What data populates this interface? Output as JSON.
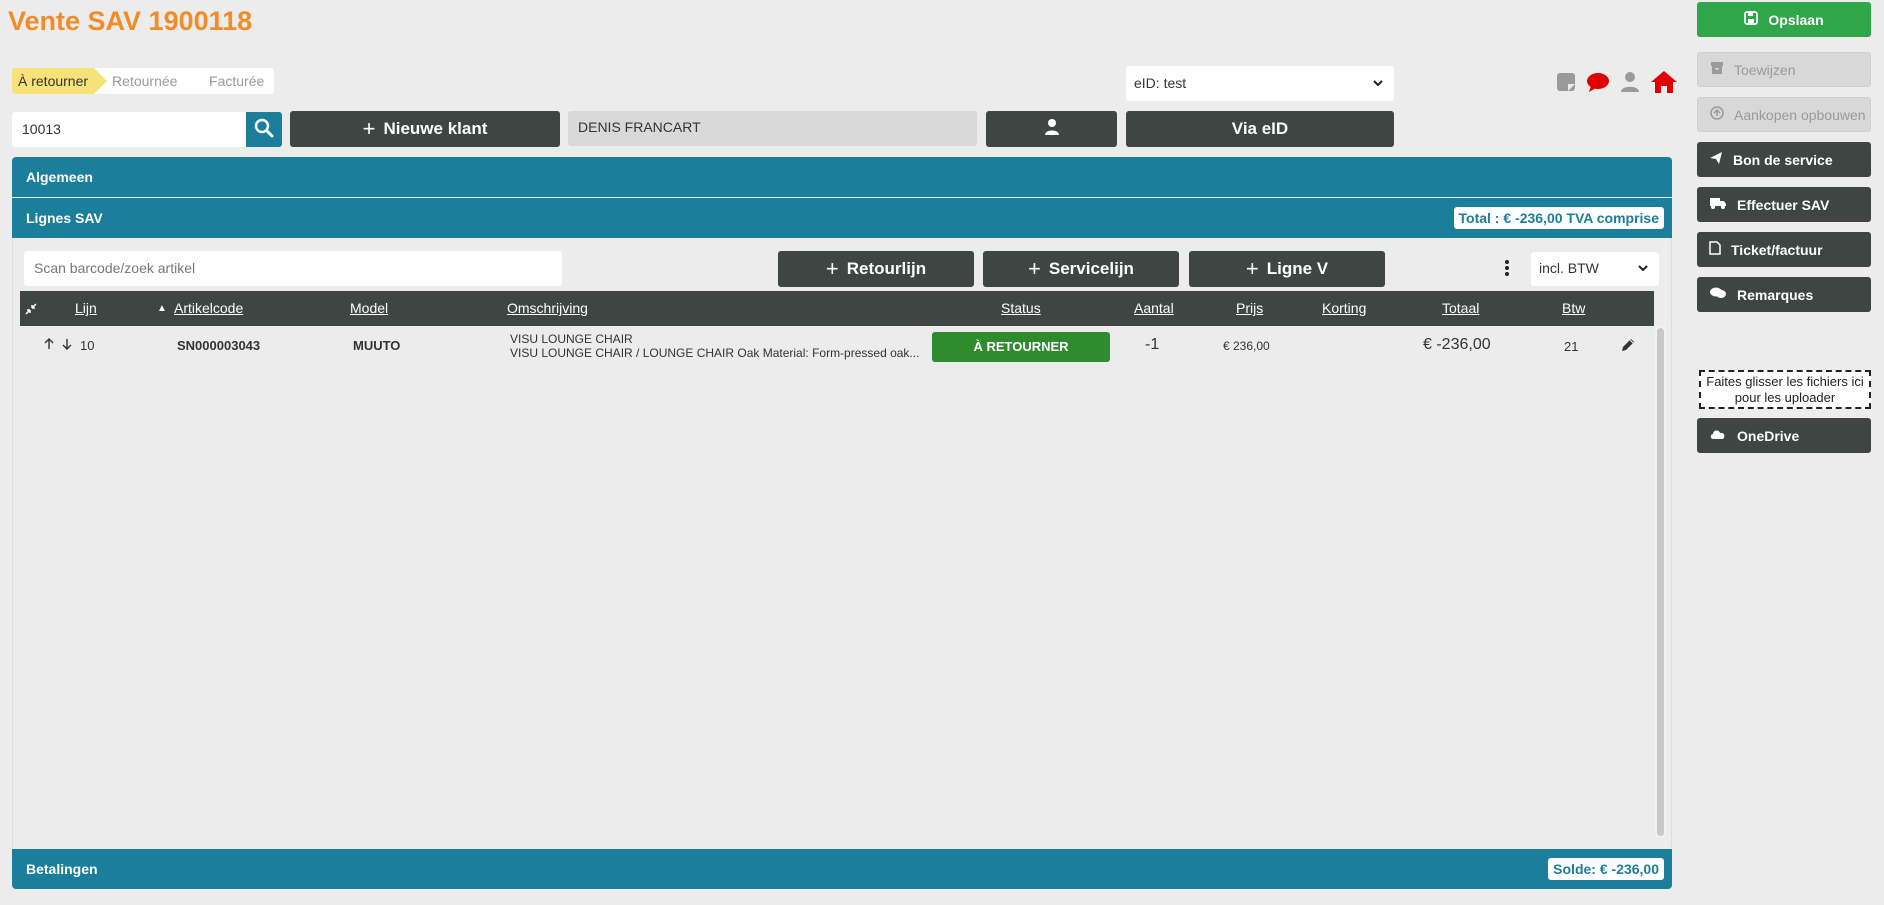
{
  "header": {
    "title": "Vente SAV 1900118"
  },
  "steps": [
    "À retourner",
    "Retournée",
    "Facturée"
  ],
  "eid_select": {
    "value": "eID: test"
  },
  "customer": {
    "number": "10013",
    "new_button": "Nieuwe klant",
    "name": "DENIS FRANCART",
    "via_eid_button": "Via eID"
  },
  "sections": {
    "algemeen": "Algemeen",
    "lignes": {
      "label": "Lignes SAV",
      "total": "Total : € -236,00 TVA comprise"
    },
    "betalingen": {
      "label": "Betalingen",
      "solde": "Solde: € -236,00"
    }
  },
  "lines_toolbar": {
    "scan_placeholder": "Scan barcode/zoek artikel",
    "retourlijn": "Retourlijn",
    "servicelijn": "Servicelijn",
    "ligne_v": "Ligne V",
    "price_mode": "incl. BTW"
  },
  "table": {
    "columns": [
      "Lijn",
      "Artikelcode",
      "Model",
      "Omschrijving",
      "Status",
      "Aantal",
      "Prijs",
      "Korting",
      "Totaal",
      "Btw"
    ],
    "rows": [
      {
        "lijn": "10",
        "artikelcode": "SN000003043",
        "model": "MUUTO",
        "omschrijving_1": "VISU LOUNGE CHAIR",
        "omschrijving_2": "VISU LOUNGE CHAIR / LOUNGE CHAIR Oak Material: Form-pressed oak...",
        "status": "À RETOURNER",
        "aantal": "-1",
        "prijs": "€ 236,00",
        "korting": "",
        "totaal": "€ -236,00",
        "btw": "21"
      }
    ]
  },
  "sidebar": {
    "save": "Opslaan",
    "assign": "Toewijzen",
    "build_purchases": "Aankopen opbouwen",
    "service_voucher": "Bon de service",
    "perform_sav": "Effectuer SAV",
    "ticket_invoice": "Ticket/factuur",
    "remarks": "Remarques",
    "dropzone_line1": "Faites glisser les fichiers ici",
    "dropzone_line2": "pour les uploader",
    "onedrive": "OneDrive"
  },
  "colors": {
    "accent_orange": "#f28c28",
    "teal": "#1b7e9a",
    "dark_button": "#3f4543",
    "green": "#2fa64a",
    "status_green": "#2e8b2e",
    "step_yellow": "#f7e27a"
  }
}
